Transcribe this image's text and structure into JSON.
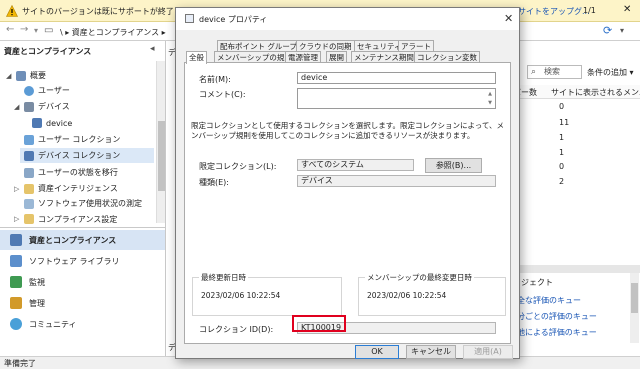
{
  "notification": {
    "text": "サイトのバージョンは既にサポートが終了しました。",
    "link": "サイトをアップグ...",
    "counter": "1/1"
  },
  "addressbar": {
    "path": "\\ ▸ 資産とコンプライアンス ▸"
  },
  "nav": {
    "title": "資産とコンプライアンス",
    "tree": [
      {
        "label": "概要",
        "depth": 0,
        "expand": "◢"
      },
      {
        "label": "ユーザー",
        "depth": 1,
        "expand": ""
      },
      {
        "label": "デバイス",
        "depth": 1,
        "expand": "◢"
      },
      {
        "label": "device",
        "depth": 2,
        "expand": ""
      },
      {
        "label": "ユーザー コレクション",
        "depth": 1,
        "expand": ""
      },
      {
        "label": "デバイス コレクション",
        "depth": 1,
        "expand": ""
      },
      {
        "label": "ユーザーの状態を移行",
        "depth": 1,
        "expand": ""
      },
      {
        "label": "資産インテリジェンス",
        "depth": 1,
        "expand": "▷"
      },
      {
        "label": "ソフトウェア使用状況の測定",
        "depth": 1,
        "expand": ""
      },
      {
        "label": "コンプライアンス設定",
        "depth": 1,
        "expand": "▷"
      }
    ],
    "workspaces": [
      {
        "label": "資産とコンプライアンス"
      },
      {
        "label": "ソフトウェア ライブラリ"
      },
      {
        "label": "監視"
      },
      {
        "label": "管理"
      },
      {
        "label": "コミュニティ"
      }
    ]
  },
  "middle": {
    "top_label": "デ",
    "bottom_label": "デ"
  },
  "results": {
    "search_label": "検索",
    "condition_label": "条件の追加 ▾",
    "columns": [
      "バー数",
      "サイトに表示されるメンバー"
    ],
    "rows": [
      "0",
      "11",
      "1",
      "1",
      "0",
      "2"
    ],
    "detail_title": "ジェクト",
    "links": [
      "全な評価のキュー",
      "分ごとの評価のキュー",
      "他による評価のキュー"
    ]
  },
  "status": {
    "text": "準備完了"
  },
  "dialog": {
    "title": "device プロパティ",
    "tabs_row1": [
      "配布ポイント グループ",
      "クラウドの同期",
      "セキュリティ",
      "アラート"
    ],
    "tabs_row2": [
      "全般",
      "メンバーシップの規則",
      "電源管理",
      "展開",
      "メンテナンス期間",
      "コレクション変数"
    ],
    "name_label": "名前(M):",
    "name_value": "device",
    "comment_label": "コメント(C):",
    "comment_value": "",
    "description": "限定コレクションとして使用するコレクションを選択します。限定コレクションによって、メンバーシップ規則を使用してこのコレクションに追加できるリソースが決まります。",
    "limit_label": "限定コレクション(L):",
    "limit_value": "すべてのシステム",
    "browse_button": "参照(B)...",
    "type_label": "種類(E):",
    "type_value": "デバイス",
    "last_update_label": "最終更新日時",
    "last_update_value": "2023/02/06 10:22:54",
    "membership_label": "メンバーシップの最終変更日時",
    "membership_value": "2023/02/06 10:22:54",
    "collection_id_label": "コレクション ID(D):",
    "collection_id_value": "KT100019",
    "ok_button": "OK",
    "cancel_button": "キャンセル",
    "apply_button": "適用(A)"
  },
  "colors": {
    "accent": "#2b7dd4",
    "highlight": "#e0001e",
    "link": "#1a56b5",
    "notif_bg": "#fdf4c8"
  }
}
